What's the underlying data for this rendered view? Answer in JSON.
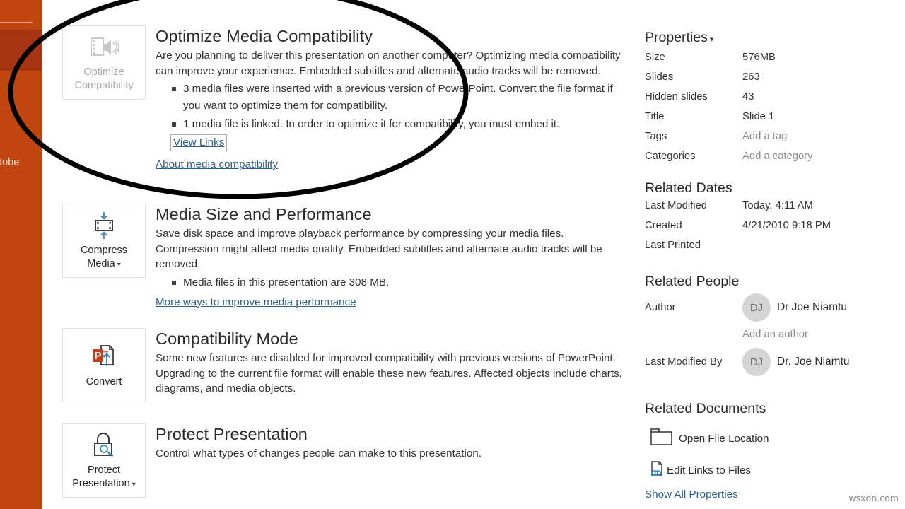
{
  "rail": {
    "truncated_label": "dobe"
  },
  "sections": [
    {
      "id": "optimize-media-compatibility",
      "button": {
        "line1": "Optimize",
        "line2": "Compatibility",
        "icon": "media-speaker-icon",
        "disabled": true
      },
      "title": "Optimize Media Compatibility",
      "paragraph": "Are you planning to deliver this presentation on another computer? Optimizing media compatibility can improve your experience. Embedded subtitles and alternate audio tracks will be removed.",
      "bullets": [
        "3 media files were inserted with a previous version of PowerPoint. Convert the file format if you want to optimize them for compatibility.",
        "1 media file is linked. In order to optimize it for compatibility, you must embed it."
      ],
      "inline_link": "View Links",
      "footer_link": "About media compatibility"
    },
    {
      "id": "media-size-and-performance",
      "button": {
        "line1": "Compress",
        "line2": "Media",
        "icon": "compress-media-icon",
        "caret": true
      },
      "title": "Media Size and Performance",
      "paragraph": "Save disk space and improve playback performance by compressing your media files. Compression might affect media quality. Embedded subtitles and alternate audio tracks will be removed.",
      "bullets": [
        "Media files in this presentation are 308 MB."
      ],
      "footer_link": "More ways to improve media performance"
    },
    {
      "id": "compatibility-mode",
      "button": {
        "line1": "Convert",
        "line2": "",
        "icon": "convert-document-icon"
      },
      "title": "Compatibility Mode",
      "paragraph": "Some new features are disabled for improved compatibility with previous versions of PowerPoint. Upgrading to the current file format will enable these new features. Affected objects include charts, diagrams, and media objects."
    },
    {
      "id": "protect-presentation",
      "button": {
        "line1": "Protect",
        "line2": "Presentation",
        "icon": "lock-key-icon",
        "caret": true
      },
      "title": "Protect Presentation",
      "paragraph": "Control what types of changes people can make to this presentation."
    }
  ],
  "properties": {
    "heading": "Properties",
    "caret": "ˇ",
    "rows": [
      {
        "key": "Size",
        "value": "576MB",
        "placeholder": false
      },
      {
        "key": "Slides",
        "value": "263",
        "placeholder": false
      },
      {
        "key": "Hidden slides",
        "value": "43",
        "placeholder": false
      },
      {
        "key": "Title",
        "value": "Slide 1",
        "placeholder": false
      },
      {
        "key": "Tags",
        "value": "Add a tag",
        "placeholder": true
      },
      {
        "key": "Categories",
        "value": "Add a category",
        "placeholder": true
      }
    ]
  },
  "related_dates": {
    "heading": "Related Dates",
    "rows": [
      {
        "key": "Last Modified",
        "value": "Today, 4:11 AM"
      },
      {
        "key": "Created",
        "value": "4/21/2010 9:18 PM"
      },
      {
        "key": "Last Printed",
        "value": ""
      }
    ]
  },
  "related_people": {
    "heading": "Related People",
    "author_label": "Author",
    "author_initials": "DJ",
    "author_name": "Dr Joe Niamtu",
    "add_author": "Add an author",
    "modified_by_label": "Last Modified By",
    "modified_by_initials": "DJ",
    "modified_by_name": "Dr. Joe Niamtu"
  },
  "related_documents": {
    "heading": "Related Documents",
    "open_file_location": "Open File Location",
    "edit_links": "Edit Links to Files",
    "show_all": "Show All Properties"
  },
  "watermark": "wsxdn.com"
}
